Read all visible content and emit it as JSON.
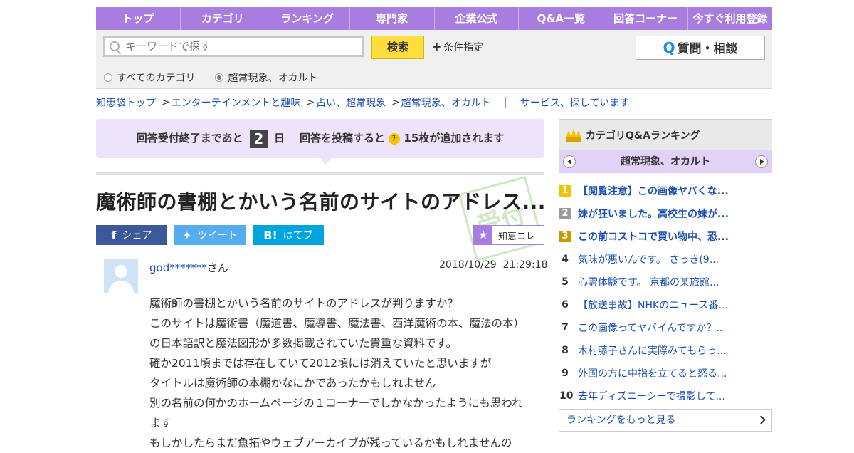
{
  "nav": {
    "items": [
      "トップ",
      "カテゴリ",
      "ランキング",
      "専門家",
      "企業公式",
      "Q&A一覧",
      "回答コーナー",
      "今すぐ利用登録"
    ]
  },
  "search": {
    "placeholder": "キーワードで探す",
    "button_label": "検索",
    "condition_label": "条件指定",
    "ask_label": "質問・相談",
    "scope_all": "すべてのカテゴリ",
    "scope_current": "超常現象、オカルト"
  },
  "breadcrumb": {
    "items": [
      "知恵袋トップ",
      "エンターテインメントと趣味",
      "占い、超常現象",
      "超常現象、オカルト"
    ],
    "service_link": "サービス、探しています"
  },
  "banner": {
    "prefix": "回答受付終了まであと",
    "days": "2",
    "days_unit": "日",
    "middle": "回答を投稿すると",
    "coin": "チ",
    "suffix": "15枚が追加されます"
  },
  "question": {
    "title": "魔術師の書棚とかいう名前のサイトのアドレス...",
    "user": "god*******",
    "user_suffix": "さん",
    "date": "2018/10/29",
    "time": "21:29:18",
    "body_lines": [
      "魔術師の書棚とかいう名前のサイトのアドレスが判りますか？",
      "このサイトは魔術書（魔道書、魔導書、魔法書、西洋魔術の本、魔法の本）の日本語訳と魔法図形が多数掲載されていた貴重な資料です。",
      "確か2011頃までは存在していて2012頃には消えていたと思いますが",
      "タイトルは魔術師の本棚かなにかであったかもしれません",
      "別の名前の何かのホームページの１コーナーでしかなかったようにも思われます",
      "もしかしたらまだ魚拓やウェブアーカイブが残っているかもしれませんの"
    ]
  },
  "share": {
    "facebook": "シェア",
    "twitter": "ツイート",
    "hatena": "はてブ",
    "hatena_icon": "B!",
    "chie_colle": "知恵コレ"
  },
  "sidebar": {
    "title": "カテゴリQ&Aランキング",
    "category": "超常現象、オカルト",
    "ranking": [
      {
        "rank": "1",
        "text": "【閲覧注意】この画像ヤバくな..."
      },
      {
        "rank": "2",
        "text": "妹が狂いました。高校生の妹が..."
      },
      {
        "rank": "3",
        "text": "この前コストコで買い物中、恐..."
      },
      {
        "rank": "4",
        "text": "気味が悪いんです。 さっき(9..."
      },
      {
        "rank": "5",
        "text": "心霊体験です。 京都の某旅館..."
      },
      {
        "rank": "6",
        "text": "【放送事故】NHKのニュース番..."
      },
      {
        "rank": "7",
        "text": "この画像ってヤバイんですか？..."
      },
      {
        "rank": "8",
        "text": "木村藤子さんに実際みてもらっ..."
      },
      {
        "rank": "9",
        "text": "外国の方に中指を立てると怒る..."
      },
      {
        "rank": "10",
        "text": "去年ディズニーシーで撮影して..."
      }
    ],
    "more_label": "ランキングをもっと見る"
  },
  "colors": {
    "nav_purple": "#a97ce0",
    "search_yellow": "#ffde3d",
    "link_blue": "#1a4fb0",
    "facebook": "#3b5998",
    "twitter": "#55acee",
    "hatena": "#00a4de"
  }
}
